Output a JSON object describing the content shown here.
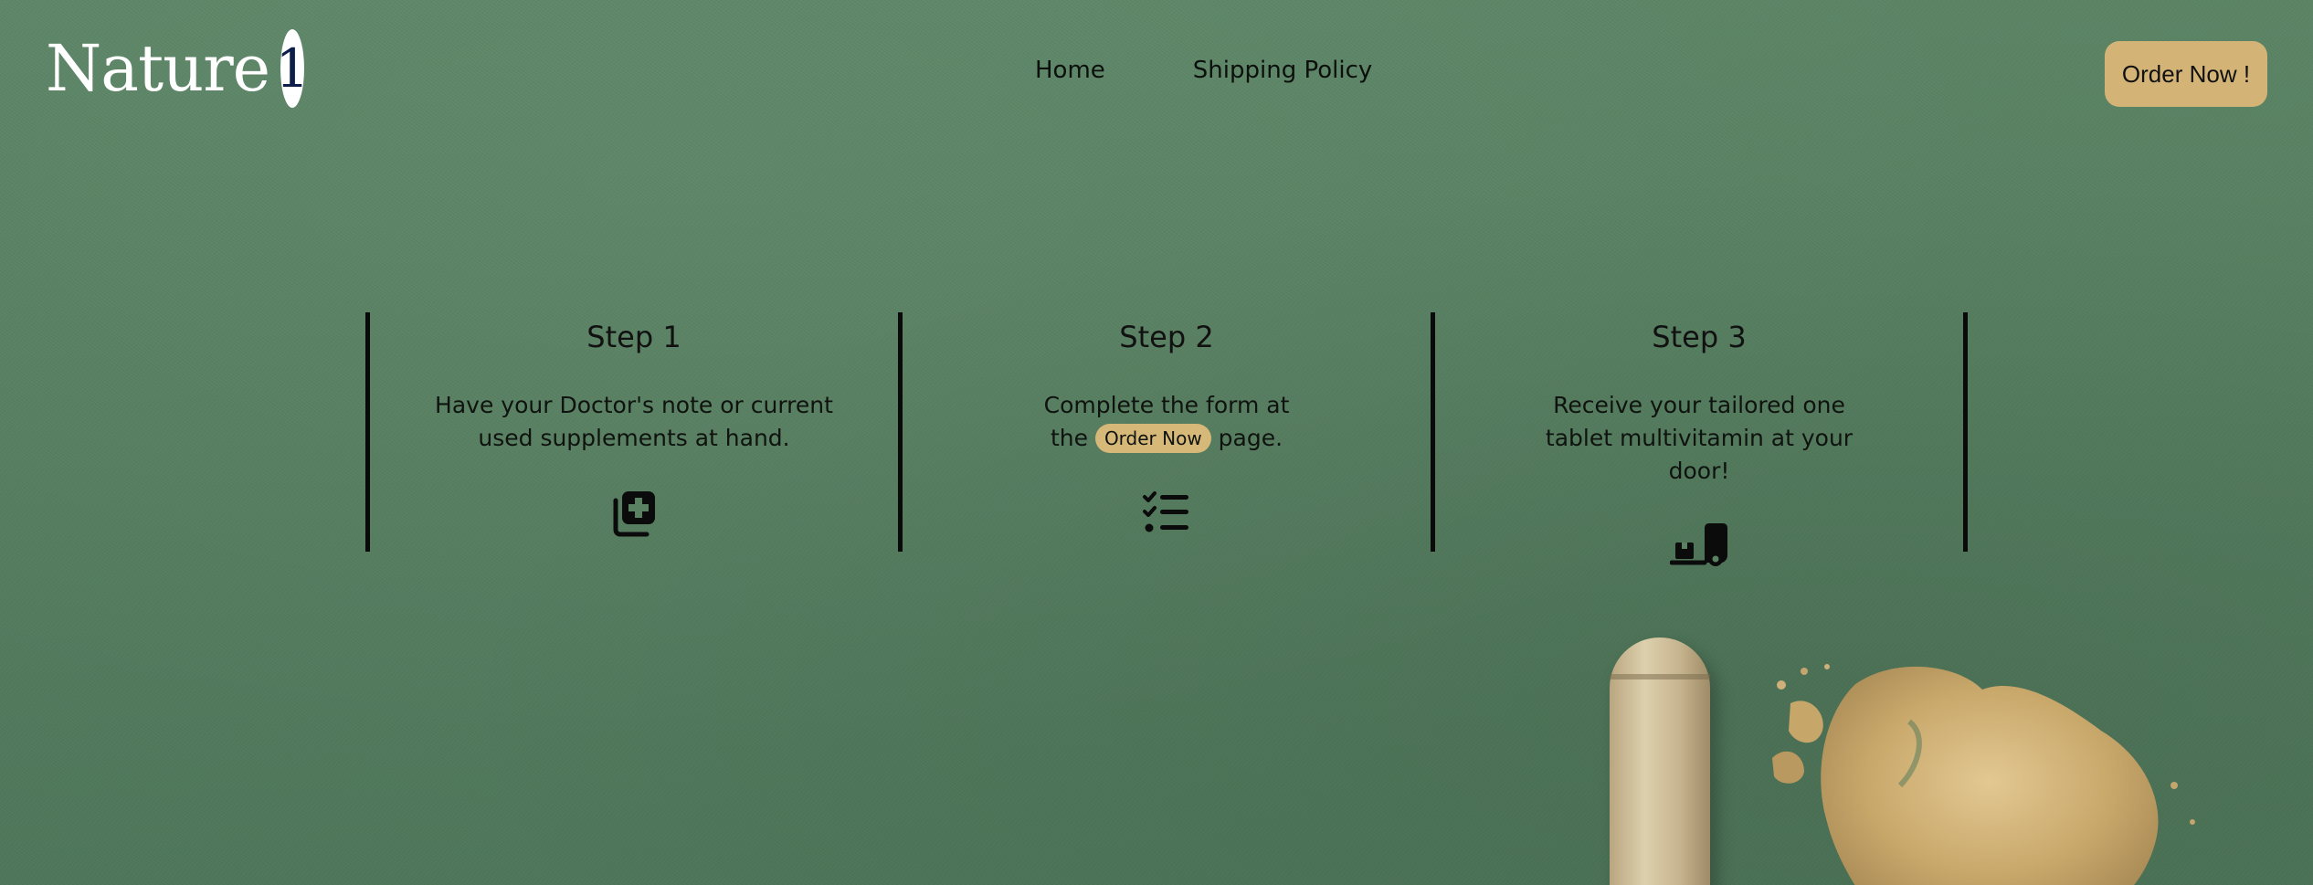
{
  "header": {
    "logo_word": "Nature",
    "logo_number": "1",
    "nav": [
      {
        "label": "Home"
      },
      {
        "label": "Shipping Policy"
      }
    ],
    "cta_label": "Order Now !"
  },
  "steps": [
    {
      "title": "Step 1",
      "text": "Have your Doctor's note or current used supplements at hand.",
      "icon": "prescription-copy-icon"
    },
    {
      "title": "Step 2",
      "text_before": "Complete the form at the",
      "pill_label": "Order Now",
      "text_after": "page.",
      "icon": "checklist-icon"
    },
    {
      "title": "Step 3",
      "text": "Receive your tailored one tablet multivitamin at your door!",
      "icon": "delivery-dolly-icon"
    }
  ],
  "colors": {
    "background": "#5a8262",
    "accent": "#d4b476",
    "text": "#0b0f0c",
    "logo_text": "#ffffff",
    "logo_number": "#0d1e4a"
  }
}
